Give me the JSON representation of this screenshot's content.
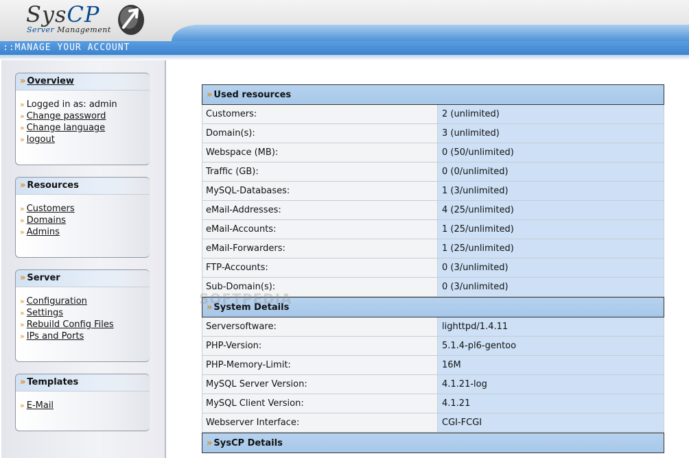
{
  "header": {
    "logo_text_a": "Sys",
    "logo_text_b": "CP",
    "logo_sub_a": "Server ",
    "logo_sub_b": "Management",
    "title": "::MANAGE YOUR ACCOUNT"
  },
  "sidebar": {
    "overview": {
      "title": "Overview",
      "items": [
        {
          "label": "Logged in as: admin"
        },
        {
          "label": "Change password"
        },
        {
          "label": "Change language"
        },
        {
          "label": "logout"
        }
      ]
    },
    "resources": {
      "title": "Resources",
      "items": [
        {
          "label": "Customers"
        },
        {
          "label": "Domains"
        },
        {
          "label": "Admins"
        }
      ]
    },
    "server": {
      "title": "Server",
      "items": [
        {
          "label": "Configuration"
        },
        {
          "label": "Settings"
        },
        {
          "label": "Rebuild Config Files"
        },
        {
          "label": "IPs and Ports"
        }
      ]
    },
    "templates": {
      "title": "Templates",
      "items": [
        {
          "label": "E-Mail"
        }
      ]
    }
  },
  "main": {
    "used_resources": {
      "title": "Used resources",
      "rows": [
        {
          "key": "Customers:",
          "value": "2 (unlimited)"
        },
        {
          "key": "Domain(s):",
          "value": "3 (unlimited)"
        },
        {
          "key": "Webspace (MB):",
          "value": "0 (50/unlimited)"
        },
        {
          "key": "Traffic (GB):",
          "value": "0 (0/unlimited)"
        },
        {
          "key": "MySQL-Databases:",
          "value": "1 (3/unlimited)"
        },
        {
          "key": "eMail-Addresses:",
          "value": "4 (25/unlimited)"
        },
        {
          "key": "eMail-Accounts:",
          "value": "1 (25/unlimited)"
        },
        {
          "key": "eMail-Forwarders:",
          "value": "1 (25/unlimited)"
        },
        {
          "key": "FTP-Accounts:",
          "value": "0 (3/unlimited)"
        },
        {
          "key": "Sub-Domain(s):",
          "value": "0 (3/unlimited)"
        }
      ]
    },
    "system_details": {
      "title": "System Details",
      "rows": [
        {
          "key": "Serversoftware:",
          "value": "lighttpd/1.4.11"
        },
        {
          "key": "PHP-Version:",
          "value": "5.1.4-pl6-gentoo"
        },
        {
          "key": "PHP-Memory-Limit:",
          "value": "16M"
        },
        {
          "key": "MySQL Server Version:",
          "value": "4.1.21-log"
        },
        {
          "key": "MySQL Client Version:",
          "value": "4.1.21"
        },
        {
          "key": "Webserver Interface:",
          "value": "CGI-FCGI"
        }
      ]
    },
    "syscp_details": {
      "title": "SysCP Details"
    }
  },
  "watermark": "SOFTPEDIA",
  "colors": {
    "accent_blue": "#3b82cf",
    "section_blue": "#a7c8ea",
    "value_cell": "#cde0f5",
    "chevron_orange": "#e08a1a"
  }
}
